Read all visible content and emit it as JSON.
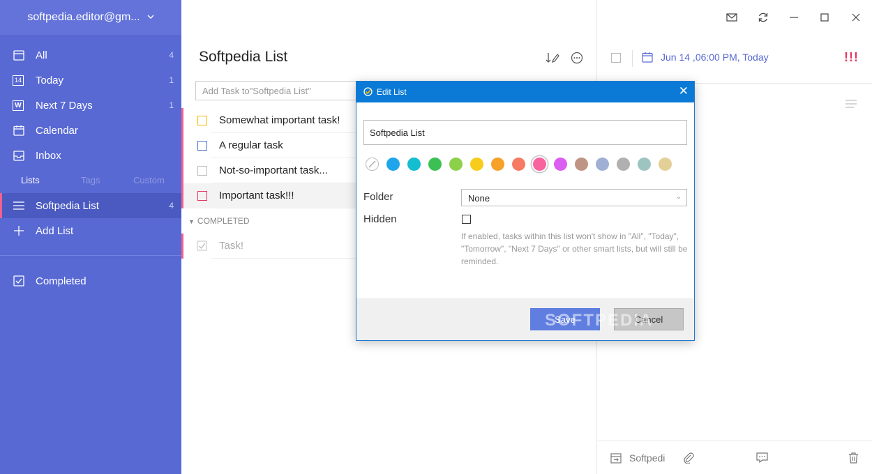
{
  "account": {
    "email": "softpedia.editor@gm..."
  },
  "sidebar": {
    "items": [
      {
        "label": "All",
        "count": "4"
      },
      {
        "label": "Today",
        "count": "1"
      },
      {
        "label": "Next 7 Days",
        "count": "1"
      },
      {
        "label": "Calendar",
        "count": ""
      },
      {
        "label": "Inbox",
        "count": ""
      }
    ],
    "tabs": [
      "Lists",
      "Tags",
      "Custom"
    ],
    "list_item": {
      "label": "Softpedia List",
      "count": "4"
    },
    "add_list": "Add List",
    "completed": "Completed",
    "today_day": "14",
    "week_letter": "W"
  },
  "main": {
    "title": "Softpedia List",
    "add_task_placeholder": "Add Task to\"Softpedia List\"",
    "tasks": [
      {
        "title": "Somewhat important task!",
        "color": "#f5b800"
      },
      {
        "title": "A regular task",
        "color": "#4a6fc8"
      },
      {
        "title": "Not-so-important task...",
        "color": "#bbbbbb"
      },
      {
        "title": "Important task!!!",
        "color": "#e5355f"
      }
    ],
    "completed_header": "COMPLETED",
    "completed_task": "Task!"
  },
  "detail": {
    "date": "Jun 14 ,06:00 PM, Today",
    "priority": "!!!",
    "title_partial": "!!!",
    "list_name": "Softpedi"
  },
  "dialog": {
    "title": "Edit List",
    "name_value": "Softpedia List",
    "colors": [
      "none",
      "#1ea5ec",
      "#14bdd0",
      "#3cc054",
      "#8dd04a",
      "#f8cc1c",
      "#f7a128",
      "#f77a62",
      "#f8629d",
      "#da5ef0",
      "#bf9484",
      "#9fb0d4",
      "#b0b0b0",
      "#9ec4c0",
      "#e2d096"
    ],
    "selected_color_index": 8,
    "folder_label": "Folder",
    "folder_value": "None",
    "hidden_label": "Hidden",
    "hint": "If enabled, tasks within this list won't show in \"All\", \"Today\", \"Tomorrow\", \"Next 7 Days\" or other smart lists, but will still be reminded.",
    "save_label": "Save",
    "cancel_label": "Cancel",
    "watermark": "SOFTPEDIA"
  },
  "colors": {
    "sidebar": "#5869d4",
    "accent": "#5869d4",
    "priority_high": "#e5355f",
    "dialog_title": "#0a7ad6"
  }
}
